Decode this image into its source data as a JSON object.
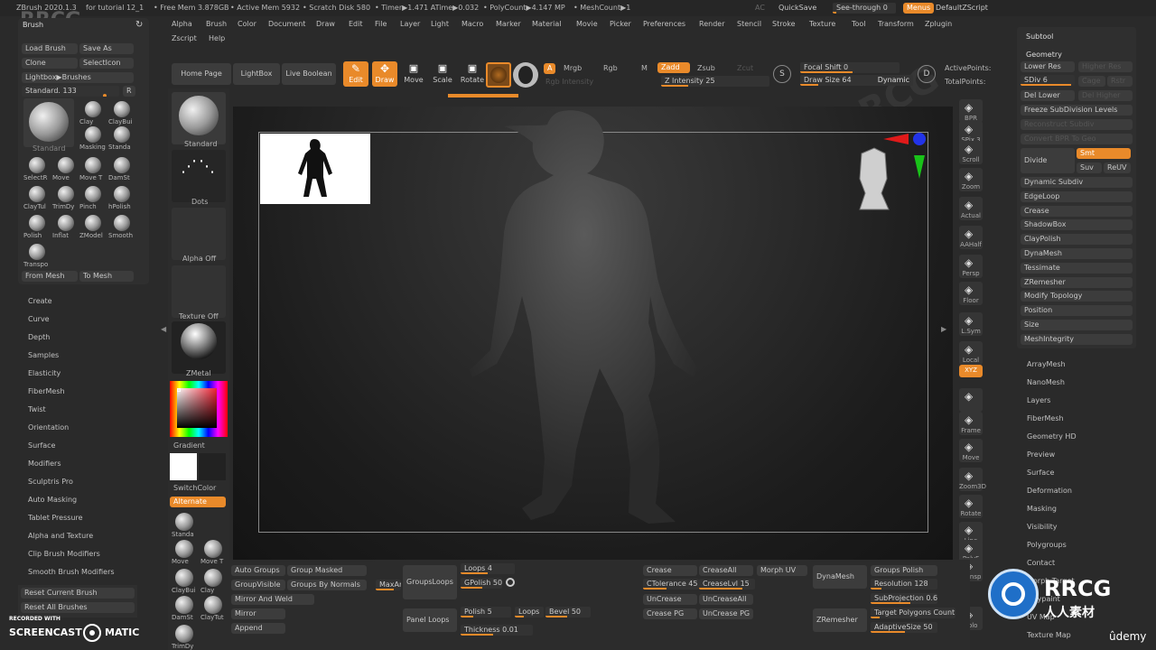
{
  "title_bar": {
    "app": "ZBrush 2020.1.3",
    "doc": "for tutorial 12_1",
    "free_mem": "• Free Mem 3.878GB",
    "active_mem": "• Active Mem 5932",
    "scratch": "• Scratch Disk 580",
    "timer": "• Timer▶1.471 ATime▶0.032",
    "polycount": "• PolyCount▶4.147 MP",
    "meshcount": "• MeshCount▶1",
    "ac": "AC",
    "quicksave": "QuickSave",
    "seethrough": "See-through  0",
    "menus": "Menus",
    "script": "DefaultZScript"
  },
  "menubar": {
    "row1": [
      "Alpha",
      "Brush",
      "Color",
      "Document",
      "Draw",
      "Edit",
      "File",
      "Layer",
      "Light",
      "Macro",
      "Marker",
      "Material",
      "Movie",
      "Picker",
      "Preferences",
      "Render",
      "Stencil",
      "Stroke",
      "Texture",
      "Tool",
      "Transform",
      "Zplugin"
    ],
    "row2": [
      "Zscript",
      "Help"
    ]
  },
  "toolbar": {
    "home": "Home Page",
    "lightbox": "LightBox",
    "liveboolean": "Live Boolean",
    "edit": "Edit",
    "draw": "Draw",
    "move": "Move",
    "scale": "Scale",
    "rotate": "Rotate",
    "a": "A",
    "mrgb": "Mrgb",
    "rgb": "Rgb",
    "m": "M",
    "zadd": "Zadd",
    "zsub": "Zsub",
    "zcut": "Zcut",
    "rgb_intensity": "Rgb Intensity",
    "z_intensity": "Z Intensity 25",
    "focal_shift": "Focal Shift 0",
    "draw_size": "Draw Size 64",
    "dynamic": "Dynamic",
    "active_points": "ActivePoints:",
    "total_points": "TotalPoints:"
  },
  "brush_panel": {
    "title": "Brush",
    "load": "Load Brush",
    "save": "Save As",
    "clone": "Clone",
    "select_icon": "SelectIcon",
    "lightbox_brushes": "Lightbox▶Brushes",
    "standard": "Standard. 133",
    "r": "R",
    "brushes": [
      "Clay",
      "ClayBui",
      "Masking",
      "Standa",
      "SelectR",
      "Move",
      "Move T",
      "DamSt",
      "ClayTul",
      "TrimDy",
      "Pinch",
      "hPolish",
      "Polish",
      "Inflat",
      "ZModel",
      "Smooth",
      "Transpo"
    ],
    "standard_label": "Standard",
    "from_mesh": "From Mesh",
    "to_mesh": "To Mesh"
  },
  "left_menu": [
    "Create",
    "Curve",
    "Depth",
    "Samples",
    "Elasticity",
    "FiberMesh",
    "Twist",
    "Orientation",
    "Surface",
    "Modifiers",
    "Sculptris Pro",
    "Auto Masking",
    "Tablet Pressure",
    "Alpha and Texture",
    "Clip Brush Modifiers",
    "Smooth Brush Modifiers"
  ],
  "left_bottom": {
    "reset_current": "Reset Current Brush",
    "reset_all": "Reset All Brushes"
  },
  "shelf": {
    "standard": "Standard",
    "dots": "Dots",
    "alpha_off": "Alpha Off",
    "texture_off": "Texture Off",
    "zmetal": "ZMetal",
    "gradient": "Gradient",
    "switchcolor": "SwitchColor",
    "alternate": "Alternate",
    "small_brushes": [
      "Standa",
      "Move",
      "Move T",
      "ClayBui",
      "Clay",
      "DamSt",
      "ClayTut",
      "TrimDy"
    ]
  },
  "right_icons": [
    "BPR",
    "SPix 3",
    "Scroll",
    "Zoom",
    "Actual",
    "AAHalf",
    "Persp",
    "Floor",
    "L.Sym",
    "Local",
    "XYZ",
    "",
    "Frame",
    "Move",
    "Zoom3D",
    "Rotate",
    "Line Fill",
    "PolyF",
    "Transp",
    "Solo"
  ],
  "geometry_panel": {
    "subtool": "Subtool",
    "geometry": "Geometry",
    "lower_res": "Lower Res",
    "higher_res": "Higher Res",
    "sdiv": "SDiv 6",
    "cage": "Cage",
    "rstr": "Rstr",
    "del_lower": "Del Lower",
    "del_higher": "Del Higher",
    "freeze": "Freeze SubDivision Levels",
    "reconstruct": "Reconstruct Subdiv",
    "convert_bpr": "Convert BPR To Geo",
    "divide": "Divide",
    "smt": "Smt",
    "suv": "Suv",
    "reuv": "ReUV",
    "items": [
      "Dynamic Subdiv",
      "EdgeLoop",
      "Crease",
      "ShadowBox",
      "ClayPolish",
      "DynaMesh",
      "Tessimate",
      "ZRemesher",
      "Modify Topology",
      "Position",
      "Size",
      "MeshIntegrity"
    ]
  },
  "tool_menu": [
    "ArrayMesh",
    "NanoMesh",
    "Layers",
    "FiberMesh",
    "Geometry HD",
    "Preview",
    "Surface",
    "Deformation",
    "Masking",
    "Visibility",
    "Polygroups",
    "Contact",
    "Morph Target",
    "Polypaint",
    "UV Map",
    "Texture Map"
  ],
  "bottom": {
    "auto_groups": "Auto Groups",
    "group_masked": "Group Masked",
    "groupvisible": "GroupVisible",
    "groups_by_normals": "Groups By Normals",
    "maxan": "MaxAn",
    "mirror_weld": "Mirror And Weld",
    "mirror": "Mirror",
    "append": "Append",
    "groupsloops": "GroupsLoops",
    "panel_loops": "Panel Loops",
    "loops_top": "Loops 4",
    "gpolish": "GPolish 50",
    "polish": "Polish 5",
    "loops": "Loops",
    "bevel": "Bevel 50",
    "thickness": "Thickness 0.01",
    "crease": "Crease",
    "creaseall": "CreaseAll",
    "ctolerance": "CTolerance 45",
    "creaselvl": "CreaseLvl 15",
    "uncrease": "UnCrease",
    "uncreaseall": "UnCreaseAll",
    "crease_pg": "Crease PG",
    "uncrease_pg": "UnCrease PG",
    "morph_uv": "Morph UV",
    "dynamesh": "DynaMesh",
    "zremesher": "ZRemesher",
    "groups_polish": "Groups  Polish",
    "resolution": "Resolution 128",
    "subprojection": "SubProjection 0.6",
    "target_polygons": "Target Polygons Count",
    "adaptive_size": "AdaptiveSize 50"
  },
  "watermark": {
    "recorded_with": "RECORDED WITH",
    "screencast": "SCREENCAST",
    "matic": "MATIC",
    "rrcg": "RRCG",
    "rrcg_cn": "人人素材",
    "udemy": "ûdemy",
    "wm_text": "RRCG",
    "wm_cn": "人人素材"
  },
  "colors": {
    "accent": "#e98a2a",
    "panel": "#2f2f2f",
    "canvas": "#1f1f1f"
  }
}
